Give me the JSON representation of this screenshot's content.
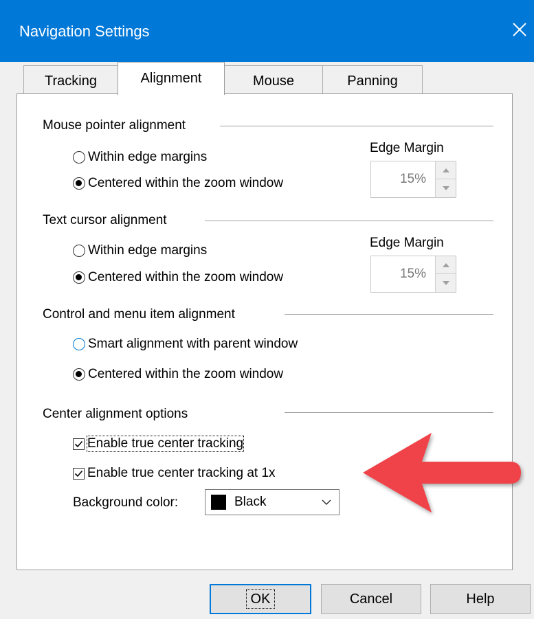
{
  "window": {
    "title": "Navigation Settings",
    "close_icon": "close-icon"
  },
  "tabs": [
    {
      "label": "Tracking",
      "active": false
    },
    {
      "label": "Alignment",
      "active": true
    },
    {
      "label": "Mouse",
      "active": false
    },
    {
      "label": "Panning",
      "active": false
    }
  ],
  "mouse_pointer": {
    "heading": "Mouse pointer alignment",
    "options": [
      "Within edge margins",
      "Centered within the zoom window"
    ],
    "selected_index": 1,
    "edge_margin_label": "Edge Margin",
    "edge_margin_value": "15%"
  },
  "text_cursor": {
    "heading": "Text cursor alignment",
    "options": [
      "Within edge margins",
      "Centered within the zoom window"
    ],
    "selected_index": 1,
    "edge_margin_label": "Edge Margin",
    "edge_margin_value": "15%"
  },
  "control_menu": {
    "heading": "Control and menu item alignment",
    "options": [
      "Smart alignment with parent window",
      "Centered within the zoom window"
    ],
    "selected_index": 1
  },
  "center_options": {
    "heading": "Center alignment options",
    "checkboxes": [
      {
        "label": "Enable true center tracking",
        "checked": true
      },
      {
        "label": "Enable true center tracking at 1x",
        "checked": true
      }
    ],
    "background_color_label": "Background color:",
    "background_color_value": "Black",
    "background_swatch": "#000000"
  },
  "buttons": {
    "ok": "OK",
    "cancel": "Cancel",
    "help": "Help"
  },
  "colors": {
    "titlebar": "#0078d7",
    "annotation_arrow": "#ef4249",
    "focus_accent": "#0078d7"
  }
}
